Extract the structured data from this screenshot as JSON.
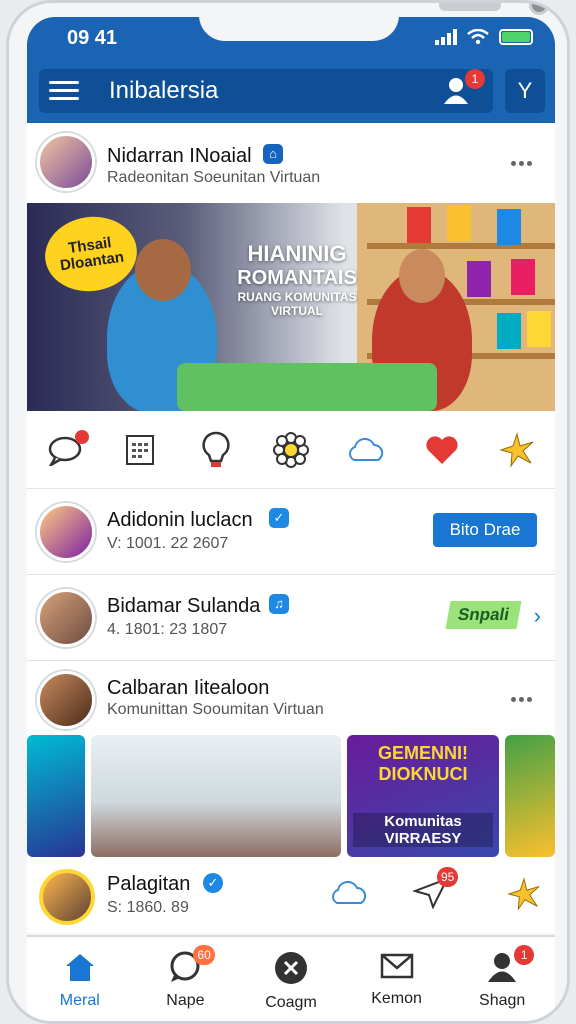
{
  "status": {
    "time": "09 41"
  },
  "appbar": {
    "title": "Inibalersia",
    "notif_count": "1"
  },
  "post1": {
    "name": "Nidarran INoaial",
    "subtitle": "Radeonitan Soeunitan Virtuan",
    "badge_text": "Thsail Dloantan",
    "hero_l1": "HIANINIG",
    "hero_l2": "ROMANTAIS",
    "hero_l3": "RUANG KOMUNITAS VIRTUAL"
  },
  "row1": {
    "name": "Adidonin luclacn",
    "meta": "V: 1001. 22 2607",
    "button": "Bito Drae"
  },
  "row2": {
    "name": "Bidamar Sulanda",
    "meta": "4. 1801: 23 1807",
    "tag": "Snpali"
  },
  "post2": {
    "name": "Calbaran Iitealoon",
    "subtitle": "Komunittan Sooumitan Virtuan",
    "tile1": "GEMENNI! DIOKNUCI",
    "tile2": "Komunitas VIRRAESY"
  },
  "pag": {
    "name": "Palagitan",
    "meta": "S: 1860. 89",
    "share_count": "95"
  },
  "tabs": [
    {
      "label": "Meral",
      "badge": ""
    },
    {
      "label": "Nape",
      "badge": "60"
    },
    {
      "label": "Coagm",
      "badge": ""
    },
    {
      "label": "Kemon",
      "badge": ""
    },
    {
      "label": "Shagn",
      "badge": "1"
    }
  ],
  "colors": {
    "primary": "#1b63b3",
    "accent": "#1976d2",
    "like": "#e53935",
    "badge": "#e53935"
  },
  "icons": [
    "menu-icon",
    "user-icon",
    "filter-icon",
    "comment-icon",
    "calendar-icon",
    "bulb-icon",
    "flower-icon",
    "cloud-icon",
    "heart-icon",
    "star-icon",
    "home-icon",
    "chat-icon",
    "close-icon",
    "mail-icon",
    "profile-icon"
  ]
}
